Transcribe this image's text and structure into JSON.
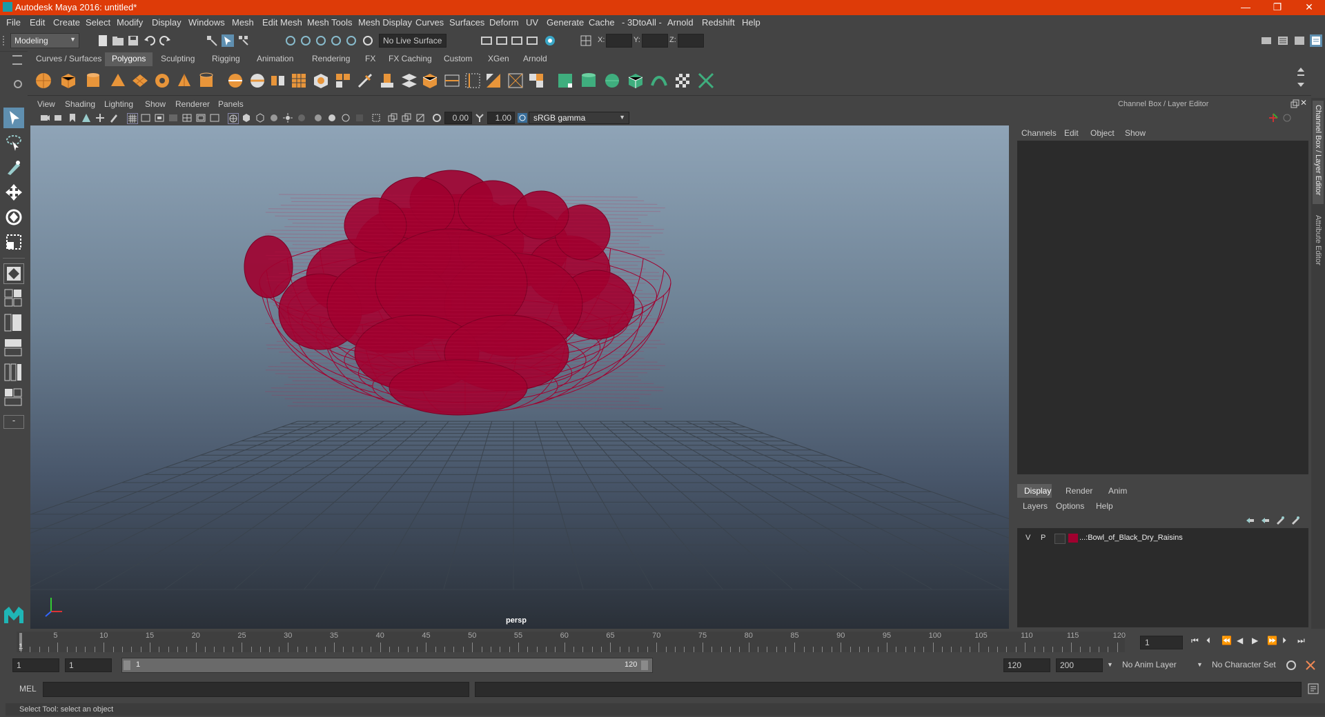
{
  "window": {
    "title": "Autodesk Maya 2016: untitled*",
    "minimize_icon": "minimize-icon",
    "restore_icon": "restore-icon",
    "close_icon": "close-icon",
    "minimize_glyph": "—",
    "restore_glyph": "❐",
    "close_glyph": "✕"
  },
  "menubar": {
    "items": [
      "File",
      "Edit",
      "Create",
      "Select",
      "Modify",
      "Display",
      "Windows",
      "Mesh",
      "Edit Mesh",
      "Mesh Tools",
      "Mesh Display",
      "Curves",
      "Surfaces",
      "Deform",
      "UV",
      "Generate",
      "Cache",
      "- 3DtoAll -",
      "Arnold",
      "Redshift",
      "Help"
    ]
  },
  "statusline": {
    "mode": "Modeling",
    "live_surface": "No Live Surface",
    "x_label": "X:",
    "y_label": "Y:",
    "z_label": "Z:"
  },
  "shelf": {
    "tabs": [
      "Curves / Surfaces",
      "Polygons",
      "Sculpting",
      "Rigging",
      "Animation",
      "Rendering",
      "FX",
      "FX Caching",
      "Custom",
      "XGen",
      "Arnold"
    ],
    "active_tab": "Polygons"
  },
  "viewport": {
    "menus": [
      "View",
      "Shading",
      "Lighting",
      "Show",
      "Renderer",
      "Panels"
    ],
    "exposure": "0.00",
    "gamma": "1.00",
    "color_space": "sRGB gamma",
    "camera_label": "persp",
    "wire_color": "#a0002f"
  },
  "channelbox": {
    "header": "Channel Box / Layer Editor",
    "menus": [
      "Channels",
      "Edit",
      "Object",
      "Show"
    ],
    "side_tab_1": "Channel Box / Layer Editor",
    "side_tab_2": "Attribute Editor"
  },
  "layereditor": {
    "tabs": [
      "Display",
      "Render",
      "Anim"
    ],
    "active_tab": "Display",
    "menus": [
      "Layers",
      "Options",
      "Help"
    ],
    "layer": {
      "v": "V",
      "p": "P",
      "name": "...:Bowl_of_Black_Dry_Raisins",
      "color": "#a0002f"
    }
  },
  "timeslider": {
    "ticks": [
      "5",
      "10",
      "15",
      "20",
      "25",
      "30",
      "35",
      "40",
      "45",
      "50",
      "55",
      "60",
      "65",
      "70",
      "75",
      "80",
      "85",
      "90",
      "95",
      "100",
      "105",
      "110",
      "115",
      "120"
    ],
    "first_frame": "1",
    "current_frame": "1"
  },
  "rangebar": {
    "start": "1",
    "anim_start": "1",
    "range_start": "1",
    "range_end": "120",
    "anim_end": "120",
    "end": "200",
    "anim_layer": "No Anim Layer",
    "character_set": "No Character Set"
  },
  "cmdline": {
    "label": "MEL"
  },
  "helpline": {
    "text": "Select Tool: select an object"
  }
}
